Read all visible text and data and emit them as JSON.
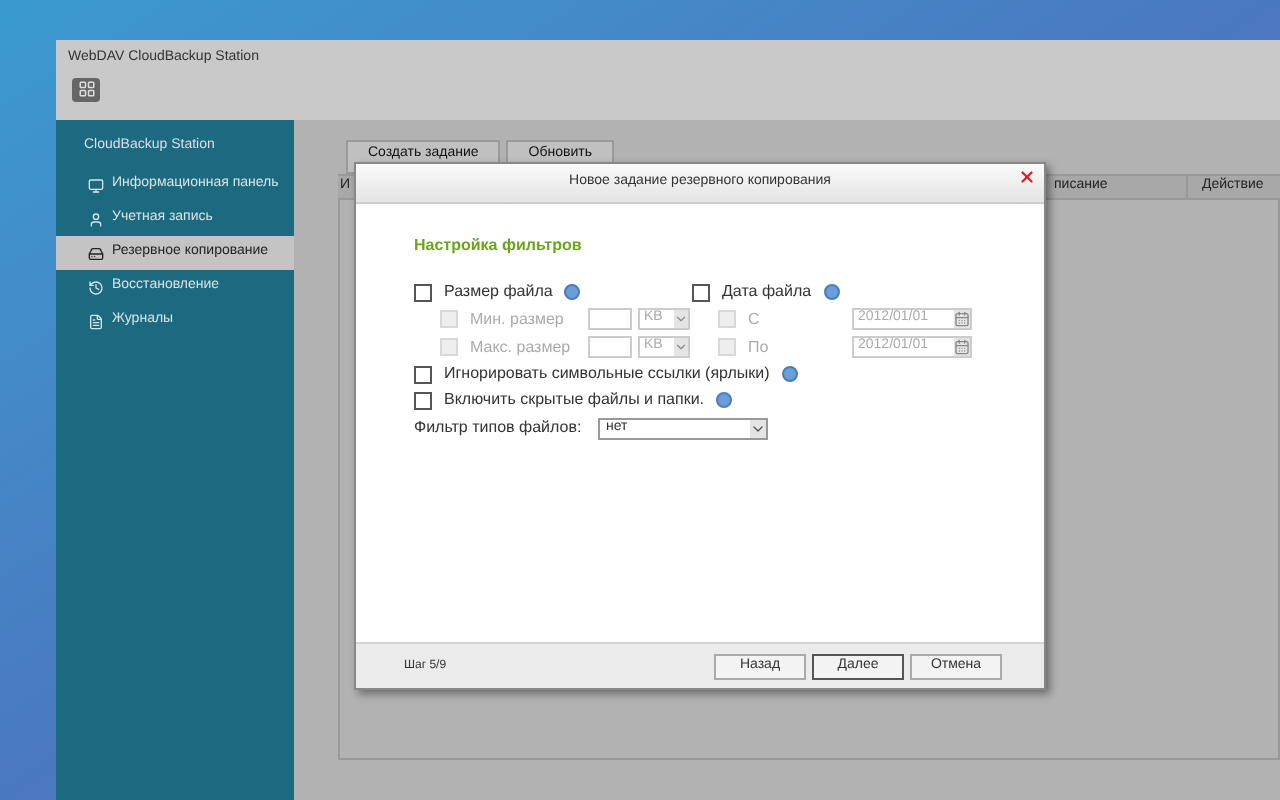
{
  "window": {
    "title": "WebDAV CloudBackup Station"
  },
  "sidebar": {
    "title": "CloudBackup Station",
    "items": [
      {
        "label": "Информационная панель",
        "selected": false
      },
      {
        "label": "Учетная запись",
        "selected": false
      },
      {
        "label": "Резервное копирование",
        "selected": true
      },
      {
        "label": "Восстановление",
        "selected": false
      },
      {
        "label": "Журналы",
        "selected": false
      }
    ]
  },
  "toolbar": {
    "buttons": [
      "Создать задание",
      "Обновить"
    ]
  },
  "table": {
    "columns": [
      "И",
      "писание",
      "Действие"
    ]
  },
  "dialog": {
    "title": "Новое задание резервного копирования",
    "heading": "Настройка фильтров",
    "size_filter": {
      "label": "Размер файла",
      "checked": false,
      "help": true,
      "rows": [
        {
          "label": "Мин. размер",
          "checked": false,
          "disabled": true,
          "value": "",
          "unit": "KB"
        },
        {
          "label": "Макс. размер",
          "checked": false,
          "disabled": true,
          "value": "",
          "unit": "KB"
        }
      ]
    },
    "date_filter": {
      "label": "Дата файла",
      "checked": false,
      "help": true,
      "rows": [
        {
          "label": "С",
          "checked": false,
          "disabled": true,
          "date": "2012/01/01"
        },
        {
          "label": "По",
          "checked": false,
          "disabled": true,
          "date": "2012/01/01"
        }
      ]
    },
    "options": [
      {
        "label": "Игнорировать символьные ссылки (ярлыки)",
        "checked": false,
        "help": true
      },
      {
        "label": "Включить скрытые файлы и папки.",
        "checked": false,
        "help": true
      }
    ],
    "file_type_filter": {
      "label": "Фильтр типов файлов:",
      "value": "нет"
    },
    "step": "Шаг 5/9",
    "buttons": [
      {
        "label": "Назад",
        "selected": false
      },
      {
        "label": "Далее",
        "selected": true
      },
      {
        "label": "Отмена",
        "selected": false
      }
    ]
  }
}
